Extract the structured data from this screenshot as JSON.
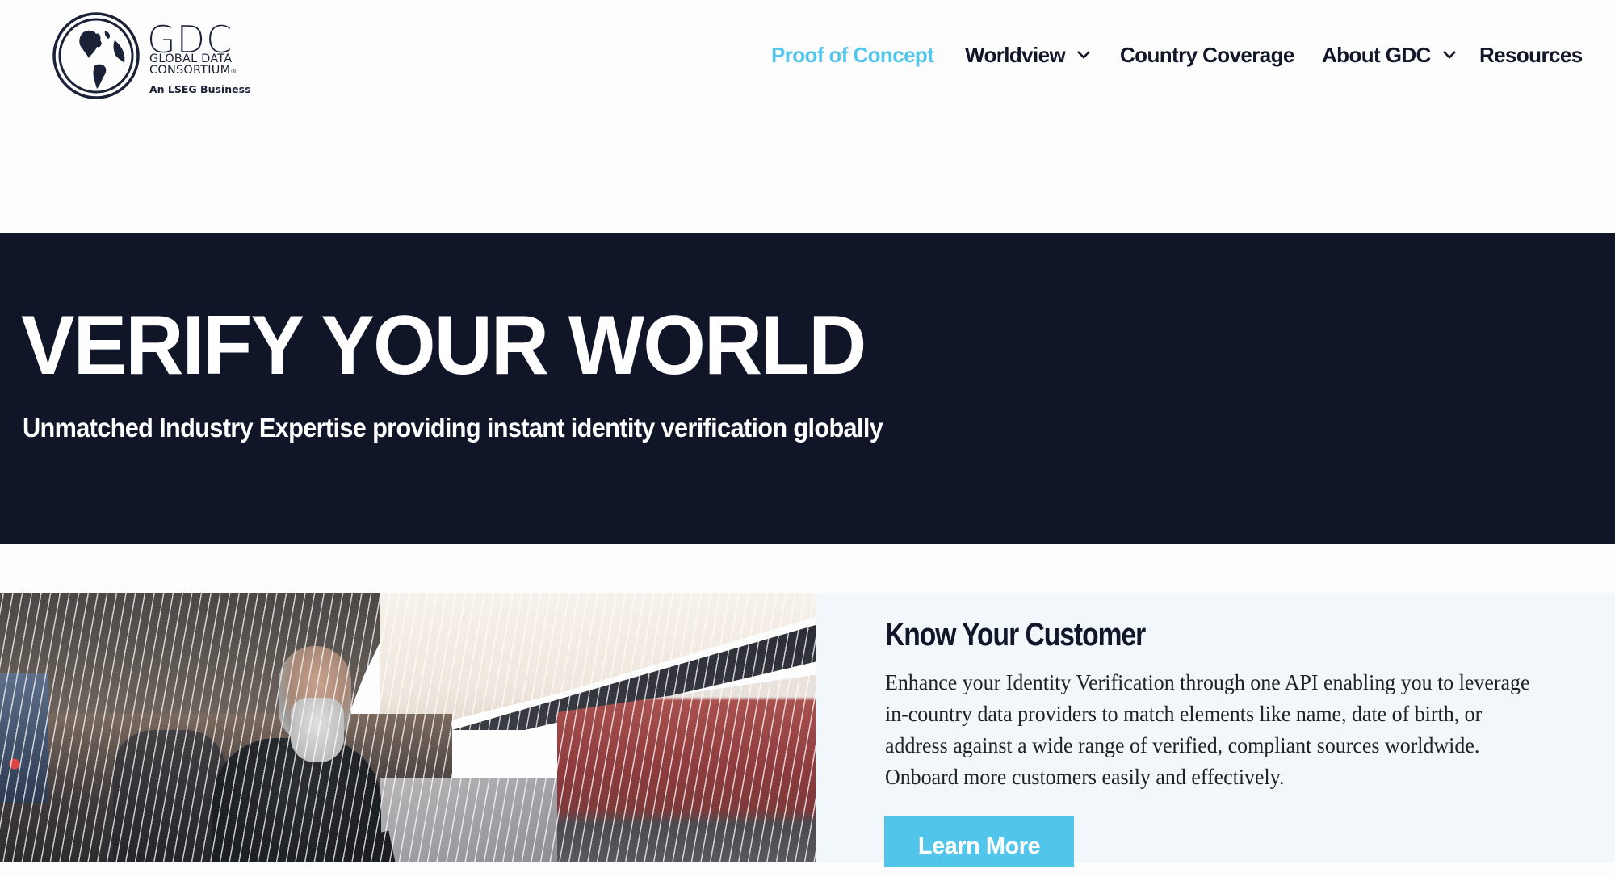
{
  "logo": {
    "brand": "GDC",
    "name_line1": "GLOBAL DATA",
    "name_line2": "CONSORTIUM",
    "registered_mark": "®",
    "tagline": "An LSEG Business",
    "icon": "globe-icon"
  },
  "nav": {
    "items": [
      {
        "label": "Proof of Concept",
        "active": true,
        "has_dropdown": false
      },
      {
        "label": "Worldview",
        "active": false,
        "has_dropdown": true,
        "icon": "chevron-down-icon"
      },
      {
        "label": "Country Coverage",
        "active": false,
        "has_dropdown": false
      },
      {
        "label": "About GDC",
        "active": false,
        "has_dropdown": true,
        "icon": "chevron-down-icon"
      },
      {
        "label": "Resources",
        "active": false,
        "has_dropdown": false
      }
    ]
  },
  "hero": {
    "title": "VERIFY YOUR WORLD",
    "subtitle": "Unmatched Industry Expertise providing instant identity verification globally"
  },
  "feature": {
    "image_alt": "Man with white beard checking phone on a train platform",
    "title": "Know Your Customer",
    "body_lines": [
      "Enhance your Identity Verification through one API enabling you to leverage",
      "in-country data providers to match elements like name, date of birth, or",
      "address against a wide range of verified, compliant sources worldwide.",
      "Onboard more customers easily and effectively."
    ],
    "button_label": "Learn More"
  },
  "colors": {
    "accent": "#52c6ea",
    "navy": "#101528",
    "text": "#111628",
    "panel_bg": "#f2f7fc"
  }
}
